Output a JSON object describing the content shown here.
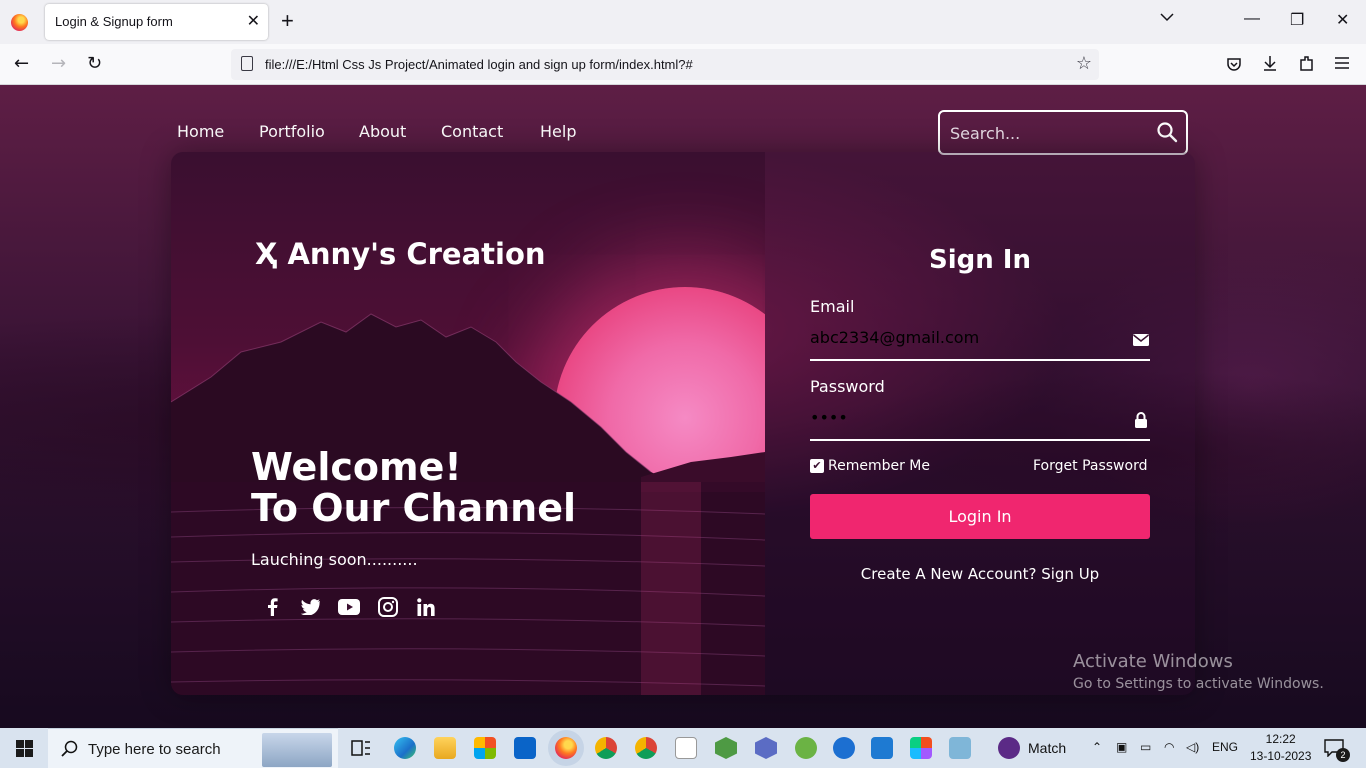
{
  "browser": {
    "tab_title": "Login & Signup form",
    "url": "file:///E:/Html Css Js Project/Animated login and sign up form/index.html?#"
  },
  "nav": {
    "links": [
      "Home",
      "Portfolio",
      "About",
      "Contact",
      "Help"
    ],
    "search_placeholder": "Search..."
  },
  "hero": {
    "brand": "Anny's Creation",
    "welcome_line1": "Welcome!",
    "welcome_line2": "To Our Channel",
    "tagline": "Lauching soon..........",
    "social_icons": [
      "facebook-icon",
      "twitter-icon",
      "youtube-icon",
      "instagram-icon",
      "linkedin-icon"
    ]
  },
  "signin": {
    "title": "Sign In",
    "email_label": "Email",
    "email_value": "abc2334@gmail.com",
    "password_label": "Password",
    "password_value": "abcd",
    "remember_label": "Remember Me",
    "remember_checked": true,
    "forget_label": "Forget Password",
    "login_button": "Login In",
    "signup_text": "Create A New Account? Sign Up"
  },
  "watermark": {
    "line1": "Activate Windows",
    "line2": "Go to Settings to activate Windows."
  },
  "taskbar": {
    "search_placeholder": "Type here to search",
    "match_label": "Match",
    "language": "ENG",
    "time": "12:22",
    "date": "13-10-2023",
    "notification_count": "2"
  },
  "colors": {
    "accent": "#f0266f",
    "sun": "#f06aa8"
  }
}
